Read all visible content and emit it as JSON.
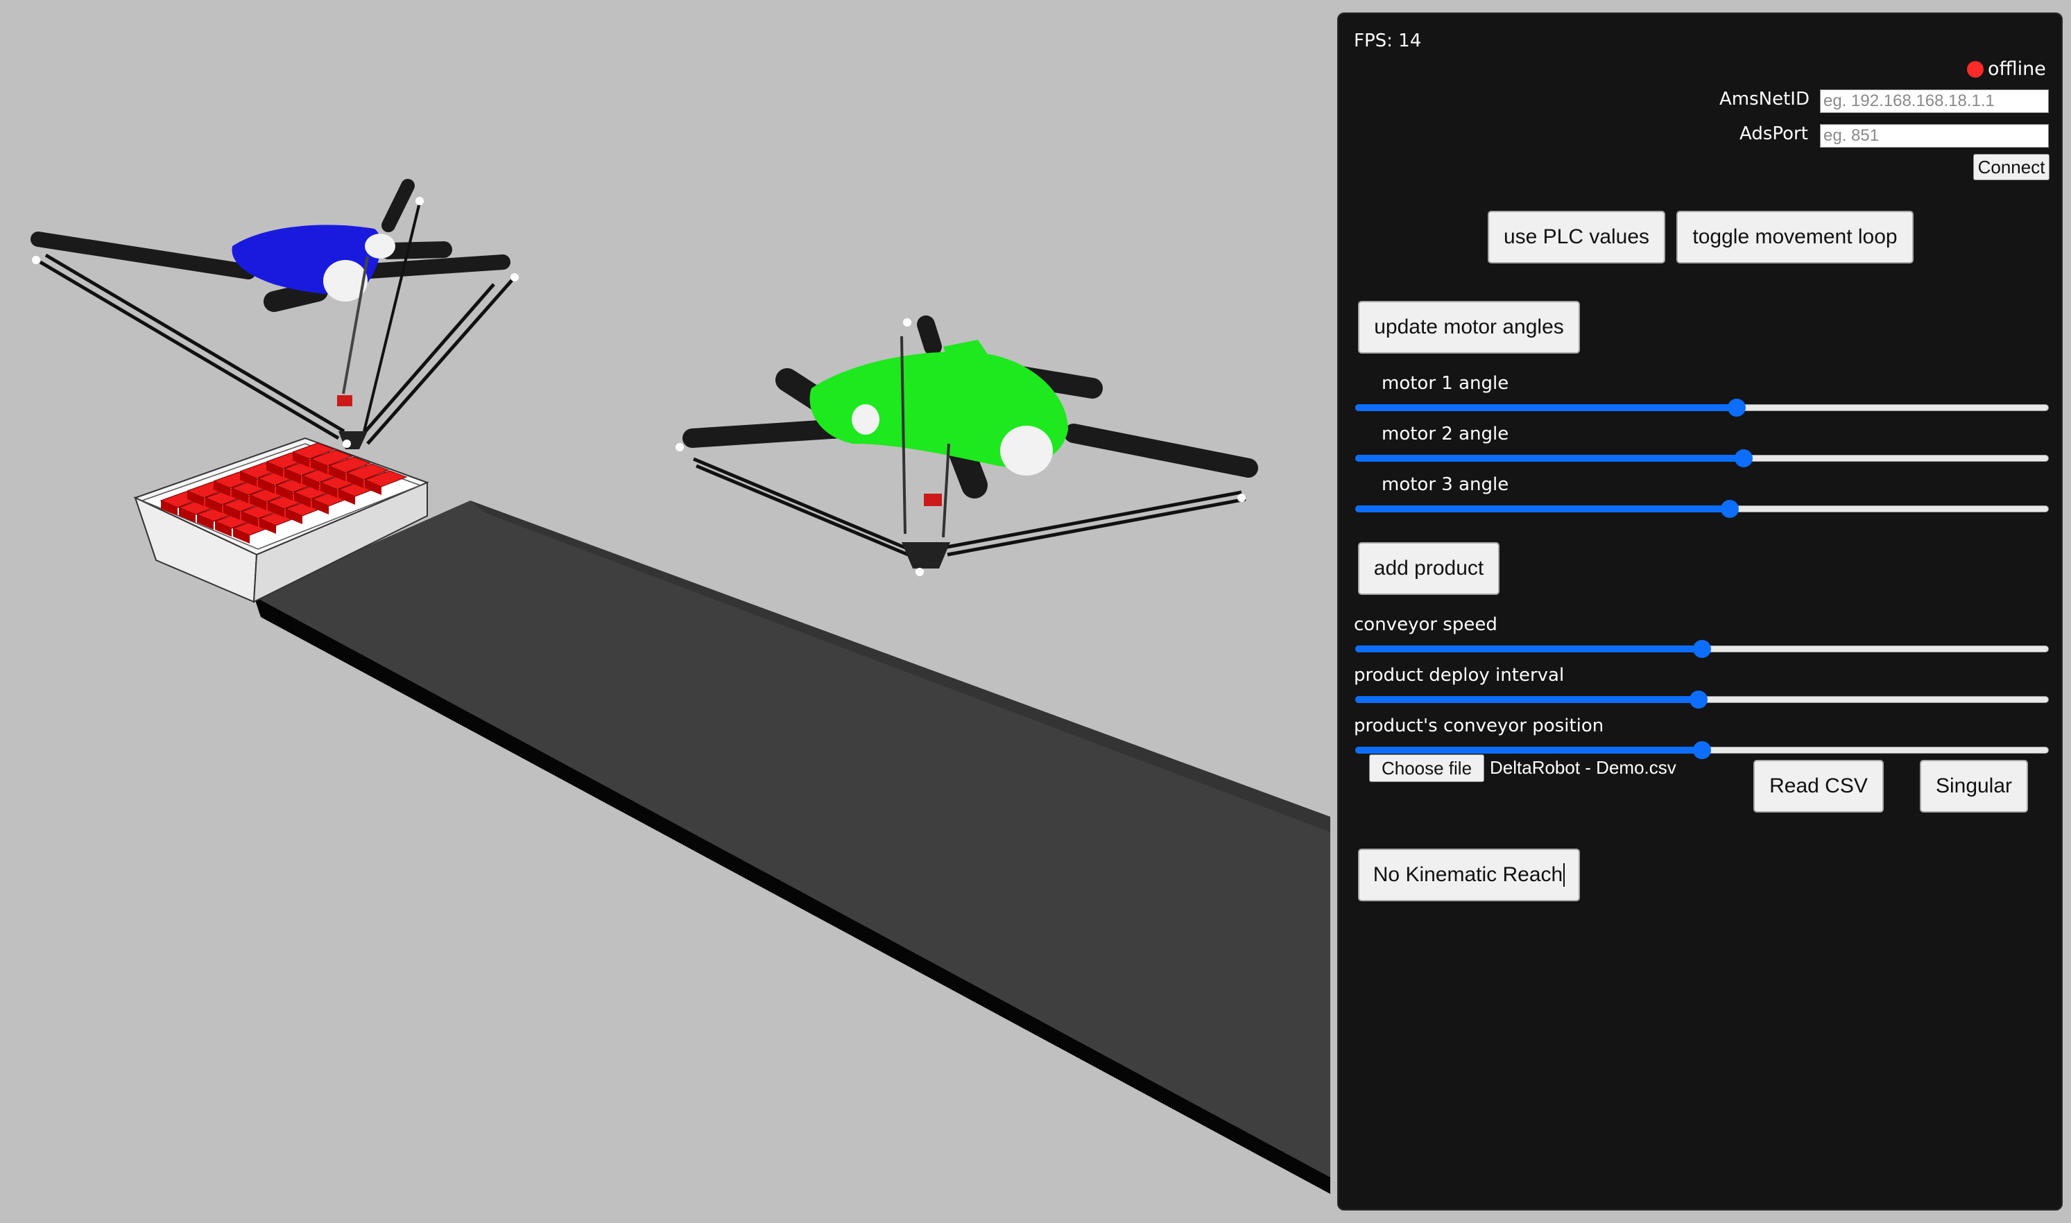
{
  "scene": {
    "background": "#c0c0c0",
    "robot_left_color": "#1a1adf",
    "robot_right_color": "#1ee81e",
    "product_color": "#ee1c1c",
    "conveyor_color": "#4a4a4a"
  },
  "panel": {
    "fps_label": "FPS: 14",
    "status": {
      "text": "offline",
      "color": "#ff2a2a"
    },
    "connection": {
      "amsnetid_label": "AmsNetID",
      "amsnetid_placeholder": "eg. 192.168.168.18.1.1",
      "amsnetid_value": "",
      "adsport_label": "AdsPort",
      "adsport_placeholder": "eg. 851",
      "adsport_value": "",
      "connect_label": "Connect"
    },
    "use_plc_label": "use PLC values",
    "toggle_loop_label": "toggle movement loop",
    "update_angles_label": "update motor angles",
    "motors": [
      {
        "label": "motor 1 angle",
        "value": 0.55
      },
      {
        "label": "motor 2 angle",
        "value": 0.56
      },
      {
        "label": "motor 3 angle",
        "value": 0.54
      }
    ],
    "add_product_label": "add product",
    "conveyor": [
      {
        "label": "conveyor speed",
        "value": 0.5
      },
      {
        "label": "product deploy interval",
        "value": 0.495
      },
      {
        "label": "product's conveyor position",
        "value": 0.5
      }
    ],
    "file": {
      "button_label": "Choose file",
      "filename": "DeltaRobot - Demo.csv"
    },
    "read_csv_label": "Read CSV",
    "singular_label": "Singular",
    "kinematic_label": "No Kinematic Reach"
  }
}
